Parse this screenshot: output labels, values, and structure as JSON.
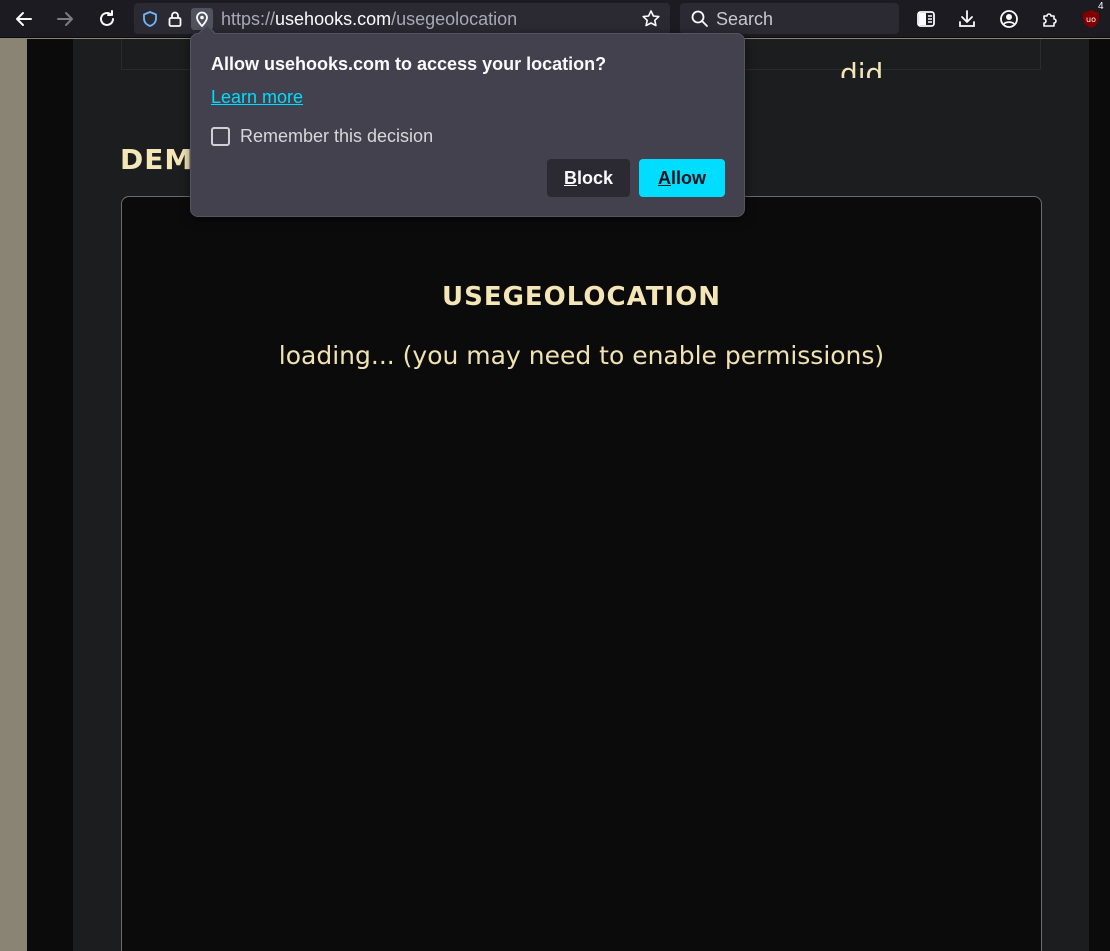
{
  "browser": {
    "url_scheme": "https://",
    "url_host": "usehooks.com",
    "url_path": "/usegeolocation",
    "search_placeholder": "Search",
    "extension_badge": "4",
    "icons": [
      "back-icon",
      "forward-icon",
      "reload-icon",
      "shield-icon",
      "lock-icon",
      "location-icon",
      "star-icon",
      "search-icon",
      "sidebar-icon",
      "download-icon",
      "account-icon",
      "extensions-icon",
      "ublock-icon"
    ]
  },
  "page": {
    "prev_text_fragment": "did.",
    "demo_heading": "DEMO",
    "demo_title": "USEGEOLOCATION",
    "demo_status": "loading... (you may need to enable permissions)"
  },
  "permission_popup": {
    "title": "Allow usehooks.com to access your location?",
    "learn_more": "Learn more",
    "remember_label": "Remember this decision",
    "remember_checked": false,
    "block_key": "B",
    "block_rest": "lock",
    "allow_key": "A",
    "allow_rest": "llow"
  },
  "colors": {
    "accent": "#00ddff",
    "page_text": "#f5e6b8",
    "popup_bg": "#42414d",
    "toolbar_bg": "#1c1b22"
  }
}
